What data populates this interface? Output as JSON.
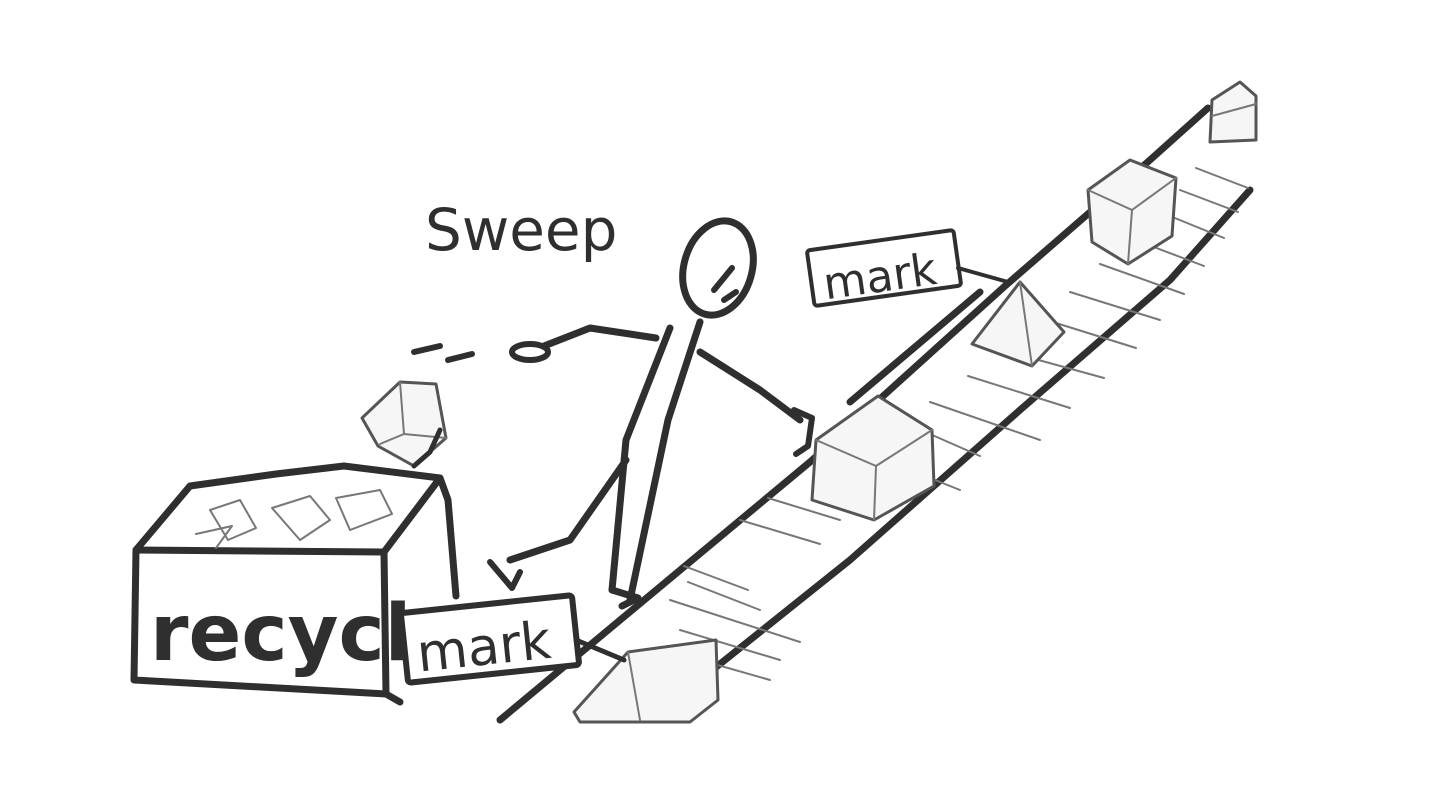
{
  "labels": {
    "action": "Sweep",
    "bin": "recycle",
    "tag_top": "mark",
    "tag_bottom": "mark"
  },
  "colors": {
    "ink": "#2f2f2f",
    "belt_line": "#777777",
    "paper": "#ffffff"
  }
}
